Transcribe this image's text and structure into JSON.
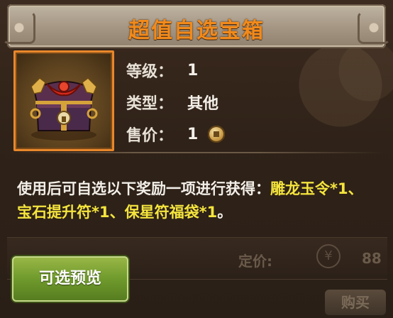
{
  "title": "超值自选宝箱",
  "item": {
    "level_label": "等级：",
    "level_value": "1",
    "type_label": "类型：",
    "type_value": "其他",
    "price_label": "售价：",
    "price_value": "1",
    "price_currency_icon": "copper-coin-icon"
  },
  "description": {
    "prefix": "使用后可自选以下奖励一项进行获得：",
    "rewards": "雕龙玉令*1、宝石提升符*1、保星符福袋*1",
    "suffix": "。"
  },
  "background_shop": {
    "price_label": "定价:",
    "currency_symbol": "¥",
    "price_value": "88",
    "buy_label": "购买"
  },
  "buttons": {
    "preview_label": "可选预览"
  },
  "colors": {
    "title": "#f28a1a",
    "highlight": "#f4e43d",
    "preview_button": "#6f9a2c",
    "icon_border": "#e9872b"
  }
}
